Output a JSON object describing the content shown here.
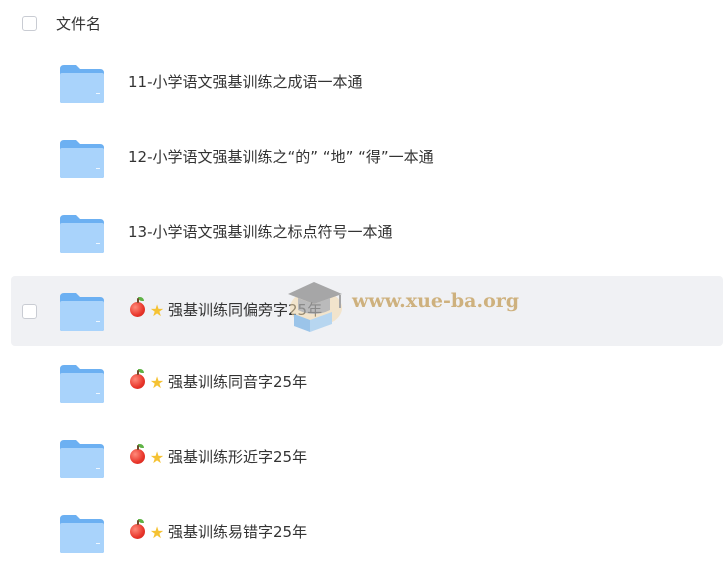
{
  "header": {
    "label": "文件名"
  },
  "items": [
    {
      "name": "11-小学语文强基训练之成语一本通",
      "emoji": false
    },
    {
      "name": "12-小学语文强基训练之“的” “地” “得”一本通",
      "emoji": false
    },
    {
      "name": "13-小学语文强基训练之标点符号一本通",
      "emoji": false
    },
    {
      "name": "强基训练同偏旁字25年",
      "emoji": true,
      "hover": true
    },
    {
      "name": "强基训练同音字25年",
      "emoji": true
    },
    {
      "name": "强基训练形近字25年",
      "emoji": true
    },
    {
      "name": "强基训练易错字25年",
      "emoji": true
    }
  ],
  "watermark": {
    "text": "www.xue-ba.org",
    "icon": "graduation-cap-books-logo"
  },
  "icons": {
    "folder": "folder-icon",
    "apple": "apple-icon",
    "star": "star-icon"
  },
  "colors": {
    "folder_light": "#a9d3fb",
    "folder_dark": "#6cb0f2",
    "hover_bg": "#f0f1f4",
    "watermark": "#c9a76a"
  }
}
